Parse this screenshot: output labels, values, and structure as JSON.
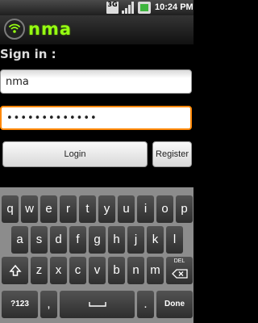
{
  "status": {
    "network": "3G",
    "time": "10:24 PM"
  },
  "app": {
    "logo_text": "nma"
  },
  "form": {
    "heading": "Sign in :",
    "username_value": "nma",
    "password_masked": "•••••••••••••",
    "login_label": "Login",
    "register_label": "Register"
  },
  "keyboard": {
    "row1": [
      "q",
      "w",
      "e",
      "r",
      "t",
      "y",
      "u",
      "i",
      "o",
      "p"
    ],
    "row2": [
      "a",
      "s",
      "d",
      "f",
      "g",
      "h",
      "j",
      "k",
      "l"
    ],
    "row3": [
      "z",
      "x",
      "c",
      "v",
      "b",
      "n",
      "m"
    ],
    "del_label": "DEL",
    "symbols_label": "?123",
    "comma": ",",
    "period": ".",
    "done_label": "Done"
  },
  "colors": {
    "accent_orange": "#ff8800",
    "logo_green": "#96ff12"
  }
}
